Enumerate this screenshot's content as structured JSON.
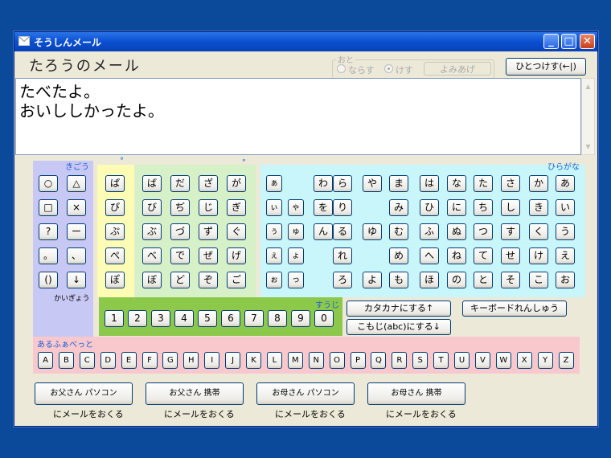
{
  "window": {
    "title": "そうしんメール",
    "mail_title": "たろうのメール",
    "message_text": "たべたよ。\nおいししかったよ。"
  },
  "sound": {
    "legend": "おと",
    "option_on": "ならす",
    "option_off": "けす",
    "read_button": "よみあげ"
  },
  "buttons": {
    "undo": "ひとつけす(←|)",
    "katakana": "カタカナにする↑",
    "keyboard_practice": "キーボードれんしゅう",
    "komoji": "こもじ(abc)にする↓"
  },
  "labels": {
    "kigou": "きごう",
    "kaigyou": "かいぎょう",
    "handakuten": "°",
    "dakuten": "\"",
    "hiragana": "ひらがな",
    "suuji": "すうじ",
    "alphabet": "あるふぁべっと",
    "send_suffix": "にメールをおくる"
  },
  "symbol_keys": [
    [
      "○",
      "△"
    ],
    [
      "□",
      "×"
    ],
    [
      "?",
      "ー"
    ],
    [
      "。",
      "、"
    ],
    [
      "()",
      "↓"
    ]
  ],
  "handakuten_keys": [
    "ぱ",
    "ぴ",
    "ぷ",
    "ぺ",
    "ぽ"
  ],
  "dakuten_keys": [
    [
      "ば",
      "だ",
      "ざ",
      "が"
    ],
    [
      "び",
      "ぢ",
      "じ",
      "ぎ"
    ],
    [
      "ぶ",
      "づ",
      "ず",
      "ぐ"
    ],
    [
      "べ",
      "で",
      "ぜ",
      "げ"
    ],
    [
      "ぼ",
      "ど",
      "ぞ",
      "ご"
    ]
  ],
  "hiragana_rows": [
    [
      "ぁ",
      "",
      "わ",
      "ら",
      "や",
      "ま",
      "は",
      "な",
      "た",
      "さ",
      "か",
      "あ"
    ],
    [
      "ぃ",
      "ゃ",
      "を",
      "り",
      "",
      "み",
      "ひ",
      "に",
      "ち",
      "し",
      "き",
      "い"
    ],
    [
      "ぅ",
      "ゅ",
      "ん",
      "る",
      "ゆ",
      "む",
      "ふ",
      "ぬ",
      "つ",
      "す",
      "く",
      "う"
    ],
    [
      "ぇ",
      "ょ",
      "",
      "れ",
      "",
      "め",
      "へ",
      "ね",
      "て",
      "せ",
      "け",
      "え"
    ],
    [
      "ぉ",
      "っ",
      "",
      "ろ",
      "よ",
      "も",
      "ほ",
      "の",
      "と",
      "そ",
      "こ",
      "お"
    ]
  ],
  "number_keys": [
    "1",
    "2",
    "3",
    "4",
    "5",
    "6",
    "7",
    "8",
    "9",
    "0"
  ],
  "alphabet_keys": [
    "A",
    "B",
    "C",
    "D",
    "E",
    "F",
    "G",
    "H",
    "I",
    "J",
    "K",
    "L",
    "M",
    "N",
    "O",
    "P",
    "Q",
    "R",
    "S",
    "T",
    "U",
    "V",
    "W",
    "X",
    "Y",
    "Z"
  ],
  "recipients": [
    "お父さん パソコン",
    "お父さん 携帯",
    "お母さん パソコン",
    "お母さん 携帯"
  ],
  "colors": {
    "symbol_panel": "#c8c8f4",
    "handakuten_panel": "#fcfcb4",
    "dakuten_panel": "#d6f0c8",
    "hiragana_panel": "#c8f6fa",
    "number_panel": "#8cc84a",
    "alphabet_panel": "#f8c8cc"
  }
}
